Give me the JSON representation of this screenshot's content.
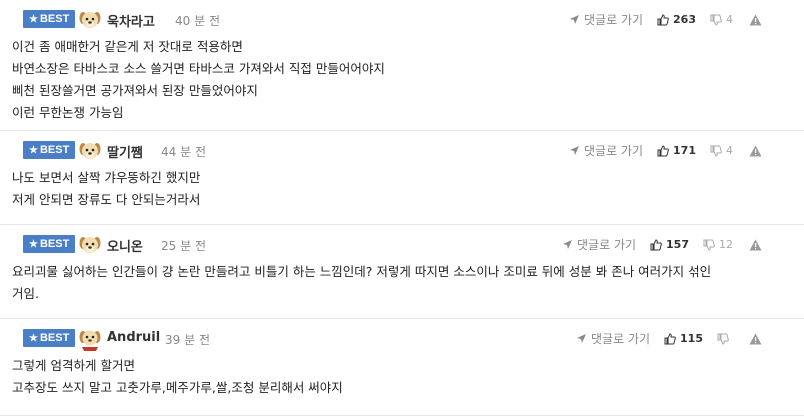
{
  "icons": {
    "badge_star": "star-icon",
    "avatar": "dog-avatar-icon",
    "reply": "reply-arrow-icon",
    "upvote": "thumbs-up-icon",
    "downvote": "thumbs-down-icon",
    "report": "warning-icon"
  },
  "colors": {
    "best_badge": "#4a7ec6"
  },
  "comments": [
    {
      "badge": "BEST",
      "nick": "욱차라고",
      "time": "40 분 전",
      "reply_label": "댓글로 가기",
      "up": "263",
      "down": "4",
      "lines": [
        "이건 좀 애매한거 같은게 저 잣대로 적용하면",
        "바연소장은 타바스코 소스 쓸거면 타바스코 가져와서 직접 만들어어야지",
        "삐천 된장쓸거면 공가져와서 된장 만들었어야지",
        "이런 무한논쟁 가능임"
      ]
    },
    {
      "badge": "BEST",
      "nick": "딸기쨈",
      "time": "44 분 전",
      "reply_label": "댓글로 가기",
      "up": "171",
      "down": "4",
      "lines": [
        "나도 보면서 살짝 갸우뚱하긴 했지만",
        "저게 안되면 장류도 다 안되는거라서"
      ]
    },
    {
      "badge": "BEST",
      "nick": "오니온",
      "time": "25 분 전",
      "reply_label": "댓글로 가기",
      "up": "157",
      "down": "12",
      "lines": [
        "요리괴물 싫어하는 인간들이 걍 논란 만들려고 비틀기 하는 느낌인데? 저렇게 따지면 소스이나 조미료 뒤에 성분 봐 존나 여러가지 섞인",
        "거임."
      ]
    },
    {
      "badge": "BEST",
      "nick": "Andruil",
      "time": "39 분 전",
      "reply_label": "댓글로 가기",
      "up": "115",
      "down": "",
      "lines": [
        "그렇게 엄격하게 할거면",
        "고추장도 쓰지 말고 고춧가루,메주가루,쌀,조청 분리해서 써야지"
      ]
    }
  ]
}
